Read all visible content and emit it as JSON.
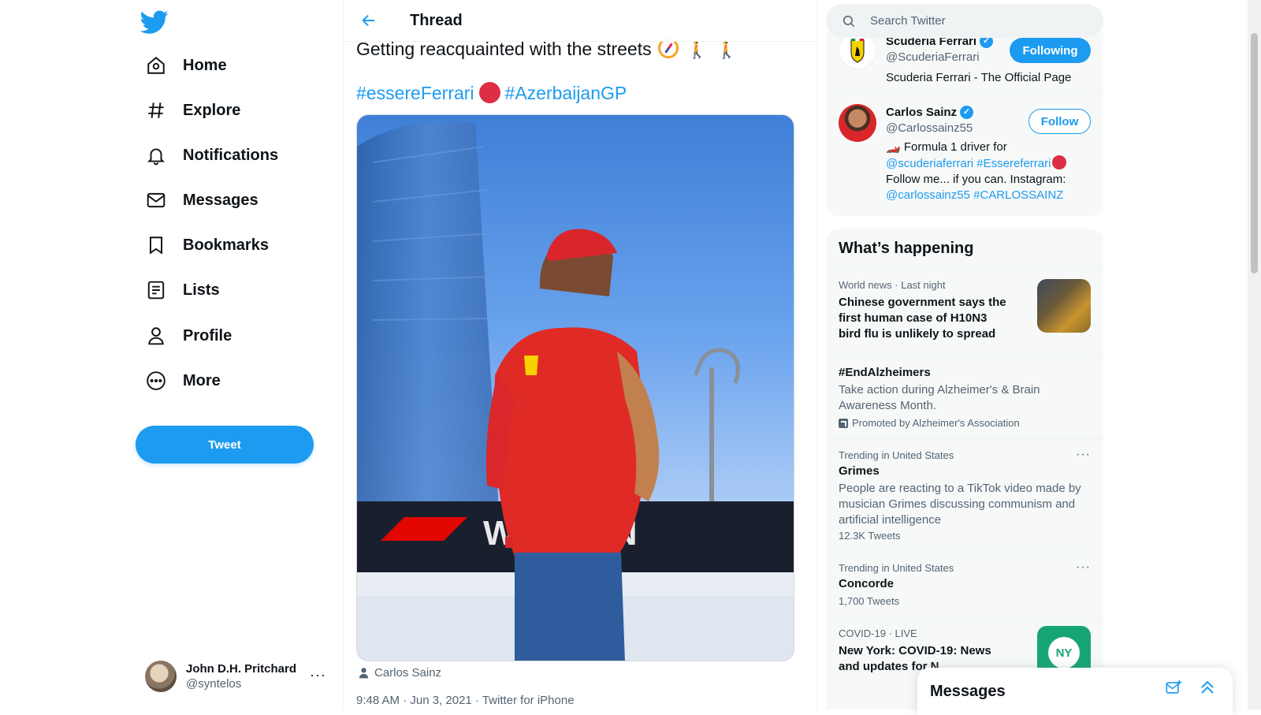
{
  "nav": {
    "items": [
      {
        "label": "Home",
        "icon": "home-icon"
      },
      {
        "label": "Explore",
        "icon": "hashtag-icon"
      },
      {
        "label": "Notifications",
        "icon": "bell-icon"
      },
      {
        "label": "Messages",
        "icon": "envelope-icon"
      },
      {
        "label": "Bookmarks",
        "icon": "bookmark-icon"
      },
      {
        "label": "Lists",
        "icon": "list-icon"
      },
      {
        "label": "Profile",
        "icon": "person-icon"
      },
      {
        "label": "More",
        "icon": "more-circle-icon"
      }
    ],
    "tweet_button": "Tweet"
  },
  "account": {
    "name": "John D.H. Pritchard",
    "handle": "@syntelos",
    "more": "···"
  },
  "header": {
    "title": "Thread"
  },
  "tweet": {
    "text": "Getting reacquainted with the streets",
    "hashtag_1": "#essereFerrari",
    "hashtag_2": "#AzerbaijanGP",
    "tagged_user": "Carlos Sainz",
    "meta": "9:48 AM · Jun 3, 2021 · Twitter for iPhone"
  },
  "search": {
    "placeholder": "Search Twitter"
  },
  "who_to_follow": [
    {
      "name": "Scuderia Ferrari",
      "handle": "@ScuderiaFerrari",
      "bio": "Scuderia Ferrari - The Official Page",
      "button": "Following"
    },
    {
      "name": "Carlos Sainz",
      "handle": "@Carlossainz55",
      "bio_prefix": "Formula 1 driver for",
      "bio_link_1": "@scuderiaferrari",
      "bio_link_2": "#Essereferrari",
      "bio_mid": "Follow me... if you can. Instagram:",
      "bio_link_3": "@carlossainz55",
      "bio_link_4": "#CARLOSSAINZ",
      "button": "Follow"
    }
  ],
  "trends": {
    "title": "What’s happening",
    "items": [
      {
        "context": "World news · Last night",
        "title": "Chinese government says the first human case of H10N3 bird flu is unlikely to spread"
      },
      {
        "title": "#EndAlzheimers",
        "description": "Take action during Alzheimer's & Brain Awareness Month.",
        "promoted": "Promoted by Alzheimer's Association"
      },
      {
        "context": "Trending in United States",
        "title": "Grimes",
        "description": "People are reacting to a TikTok video made by musician Grimes discussing communism and artificial intelligence",
        "count": "12.3K Tweets",
        "more": "···"
      },
      {
        "context": "Trending in United States",
        "title": "Concorde",
        "count": "1,700 Tweets",
        "more": "···"
      },
      {
        "context": "COVID-19 · LIVE",
        "title": "New York: COVID-19: News and updates for N",
        "thumb_text": "NY"
      }
    ]
  },
  "messages_drawer": {
    "title": "Messages"
  },
  "colors": {
    "accent": "#1d9bf0",
    "text": "#0f1419",
    "secondary": "#536471",
    "ferrari_red": "#dd2e44"
  }
}
